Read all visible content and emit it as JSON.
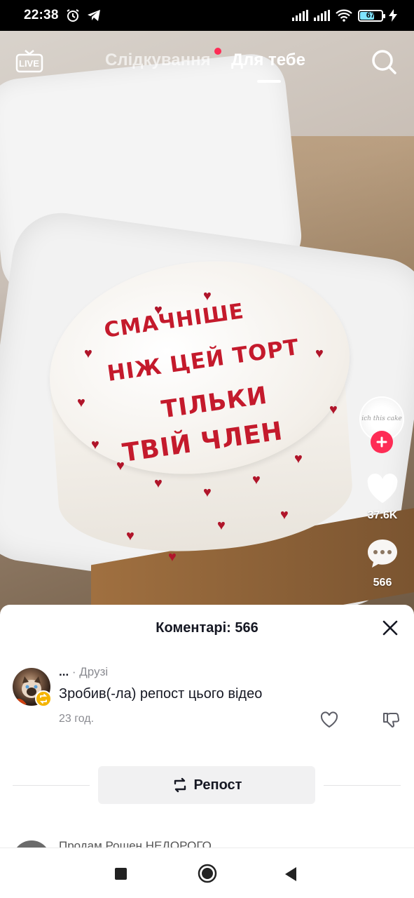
{
  "status_bar": {
    "time": "22:38",
    "battery": "67",
    "battery_level_percent": 67,
    "icons": [
      "alarm-icon",
      "telegram-icon",
      "signal-icon",
      "signal-icon",
      "wifi-icon",
      "battery-icon",
      "charging-icon"
    ]
  },
  "top_nav": {
    "live_label": "LIVE",
    "tabs": [
      {
        "label": "Слідкування",
        "active": false,
        "has_dot": true
      },
      {
        "label": "Для тебе",
        "active": true
      }
    ]
  },
  "video": {
    "cake_text_lines": [
      "СМАЧНІШЕ",
      "НІЖ ЦЕЙ ТОРТ",
      "ТІЛЬКИ",
      "ТВІЙ ЧЛЕН"
    ],
    "creator_avatar_text": "ich this cake"
  },
  "actions": {
    "likes": "37.6K",
    "comments": "566"
  },
  "comments_sheet": {
    "title": "Коментарі: 566",
    "comment": {
      "author": "...",
      "tag": "· Друзі",
      "text": "Зробив(-ла) репост цього відео",
      "time": "23 год."
    },
    "repost_label": "Репост",
    "next_author": "Продам Рошен НЕДОРОГО"
  },
  "colors": {
    "accent": "#fe2c55",
    "text_primary": "#161823",
    "text_secondary": "#8a8b91",
    "badge": "#f4b400"
  }
}
